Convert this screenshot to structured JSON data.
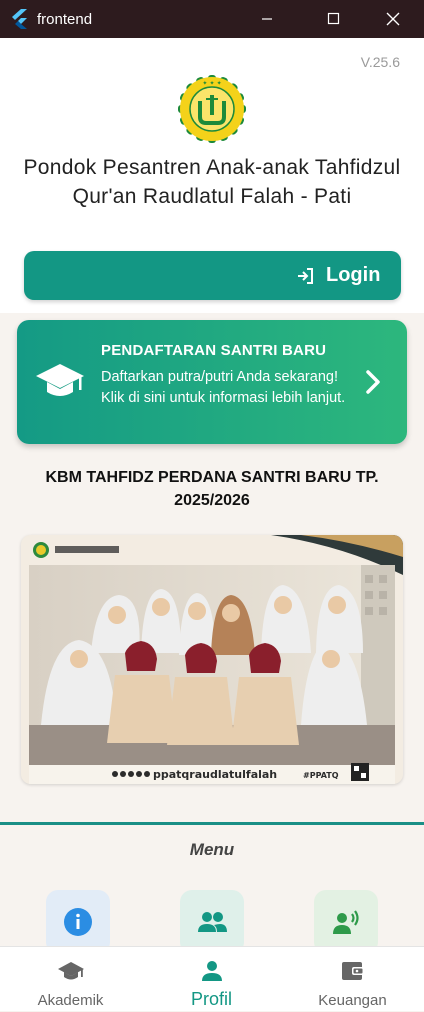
{
  "window": {
    "title": "frontend",
    "controls": {
      "minimize": "minimize-icon",
      "maximize": "maximize-icon",
      "close": "close-icon"
    }
  },
  "header": {
    "version": "V.25.6",
    "logo": {
      "icon": "institution-logo",
      "text": "YAYASAN RAUDLATUL FALAH"
    },
    "school_name": "Pondok Pesantren Anak-anak Tahfidzul Qur'an Raudlatul Falah - Pati",
    "login": {
      "label": "Login",
      "icon": "login-icon"
    }
  },
  "registration_card": {
    "title": "PENDAFTARAN SANTRI BARU",
    "description": "Daftarkan putra/putri Anda sekarang! Klik di sini untuk informasi lebih lanjut.",
    "icon": "graduation-cap-icon",
    "arrow_icon": "chevron-right-icon"
  },
  "news": {
    "title": "KBM TAHFIDZ PERDANA SANTRI BARU TP. 2025/2026",
    "photo": {
      "banner_text": "ppatqraudlatulfalah",
      "badge_text": "#PPATQ"
    }
  },
  "menu": {
    "title": "Menu",
    "items": [
      {
        "icon": "info-icon",
        "color": "#2b8de3"
      },
      {
        "icon": "group-icon",
        "color": "#139784"
      },
      {
        "icon": "speaker-icon",
        "color": "#2e9a4a"
      }
    ]
  },
  "bottom_nav": {
    "items": [
      {
        "label": "Akademik",
        "icon": "graduation-cap-icon",
        "active": false
      },
      {
        "label": "Profil",
        "icon": "person-icon",
        "active": true
      },
      {
        "label": "Keuangan",
        "icon": "wallet-icon",
        "active": false
      }
    ],
    "active_color": "#139784"
  },
  "colors": {
    "primary": "#139784",
    "titlebar": "#2d1b1e",
    "background": "#f7f3ef"
  }
}
